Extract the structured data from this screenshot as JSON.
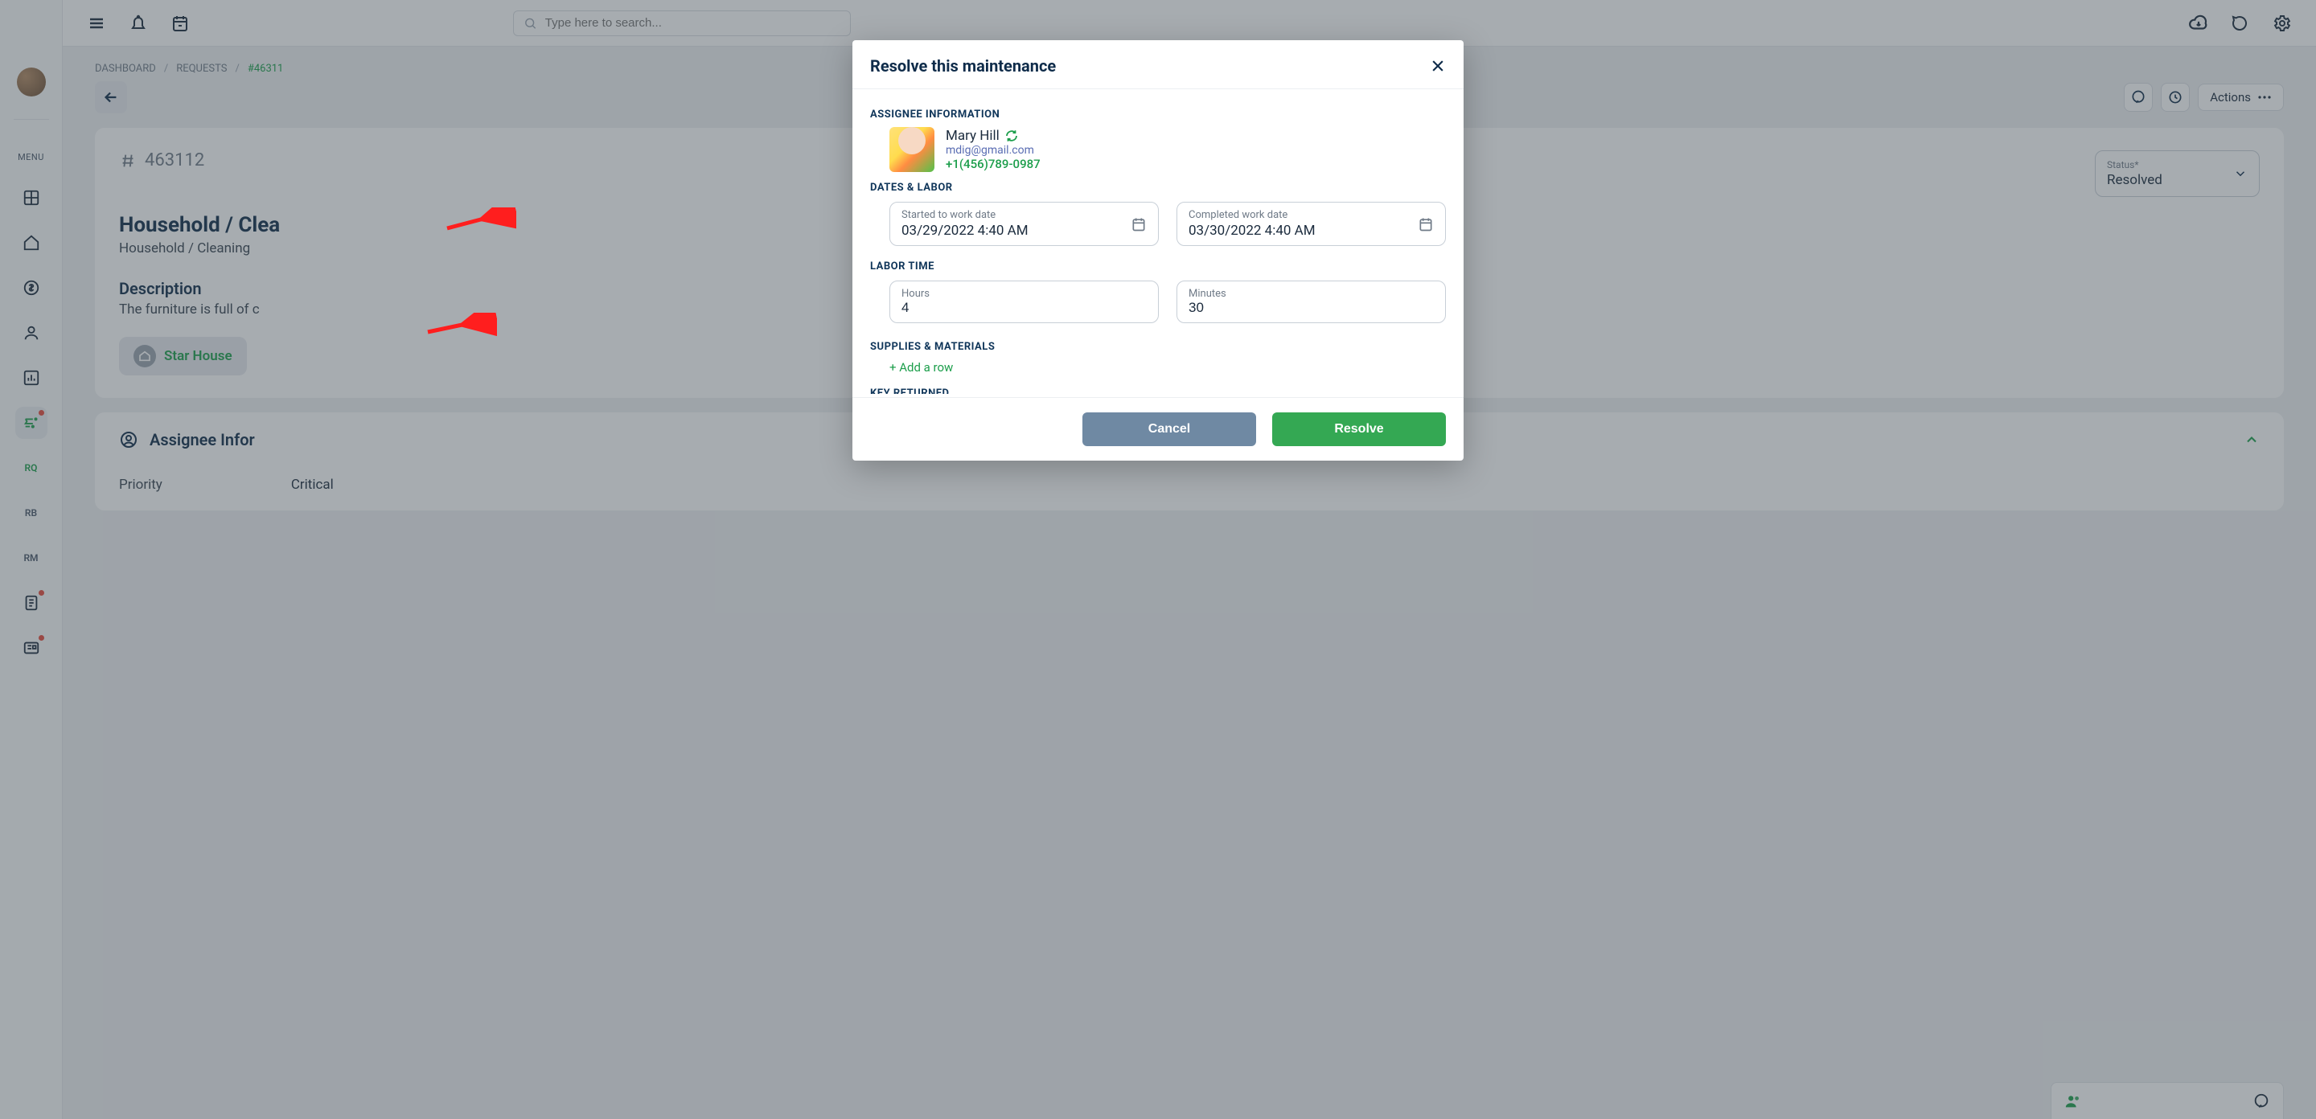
{
  "topbar": {
    "search_placeholder": "Type here to search..."
  },
  "sidebar": {
    "menu_label": "MENU",
    "rq": "RQ",
    "rb": "RB",
    "rm": "RM"
  },
  "breadcrumb": {
    "dashboard": "DASHBOARD",
    "requests": "REQUESTS",
    "current": "#46311"
  },
  "actions_label": "Actions",
  "status": {
    "label": "Status*",
    "value": "Resolved"
  },
  "request": {
    "id": "463112",
    "title": "Household / Clea",
    "subtitle": "Household / Cleaning",
    "description_heading": "Description",
    "description_text": "The furniture is full of c",
    "property_chip": "Star House"
  },
  "assignee_section": {
    "heading": "Assignee Infor",
    "priority_label": "Priority",
    "priority_value": "Critical"
  },
  "modal": {
    "title": "Resolve this maintenance",
    "sections": {
      "assignee_info": "ASSIGNEE INFORMATION",
      "dates_labor": "DATES & LABOR",
      "labor_time": "LABOR TIME",
      "supplies": "SUPPLIES & MATERIALS",
      "key_returned": "KEY RETURNED"
    },
    "assignee": {
      "name": "Mary Hill",
      "email": "mdig@gmail.com",
      "phone": "+1(456)789-0987"
    },
    "fields": {
      "started_label": "Started to work date",
      "started_value": "03/29/2022 4:40 AM",
      "completed_label": "Completed work date",
      "completed_value": "03/30/2022 4:40 AM",
      "hours_label": "Hours",
      "hours_value": "4",
      "minutes_label": "Minutes",
      "minutes_value": "30"
    },
    "add_row": "+ Add a row",
    "buttons": {
      "cancel": "Cancel",
      "resolve": "Resolve"
    }
  }
}
